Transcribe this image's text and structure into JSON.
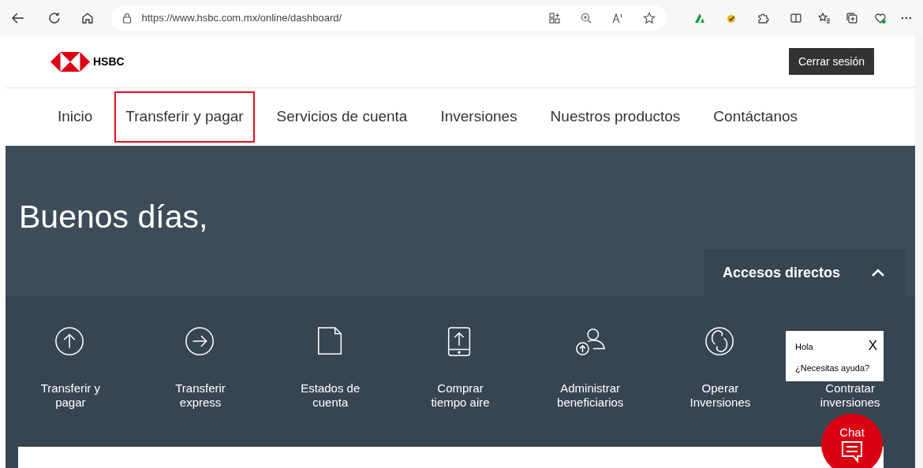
{
  "browser": {
    "url": "https://www.hsbc.com.mx/online/dashboard/"
  },
  "header": {
    "brand": "HSBC",
    "logout_button": "Cerrar sesión"
  },
  "nav": [
    {
      "label": "Inicio",
      "selected": false
    },
    {
      "label": "Transferir y pagar",
      "selected": true
    },
    {
      "label": "Servicios de cuenta",
      "selected": false
    },
    {
      "label": "Inversiones",
      "selected": false
    },
    {
      "label": "Nuestros productos",
      "selected": false
    },
    {
      "label": "Contáctanos",
      "selected": false
    }
  ],
  "greeting": "Buenos días,",
  "shortcuts_panel": {
    "title": "Accesos directos",
    "expanded": true
  },
  "shortcuts": [
    {
      "kind": "up",
      "label": "Transferir y pagar"
    },
    {
      "kind": "right",
      "label": "Transferir express"
    },
    {
      "kind": "doc",
      "label": "Estados de cuenta"
    },
    {
      "kind": "phone",
      "label": "Comprar tiempo aire"
    },
    {
      "kind": "person",
      "label": "Administrar beneficiarios"
    },
    {
      "kind": "cycle",
      "label": "Operar Inversiones"
    },
    {
      "kind": "hidden",
      "label": "Contratar inversiones"
    }
  ],
  "chat_popup": {
    "greeting": "Hola",
    "close": "X",
    "question": "¿Necesitas ayuda?"
  },
  "chat_button": {
    "label": "Chat"
  }
}
